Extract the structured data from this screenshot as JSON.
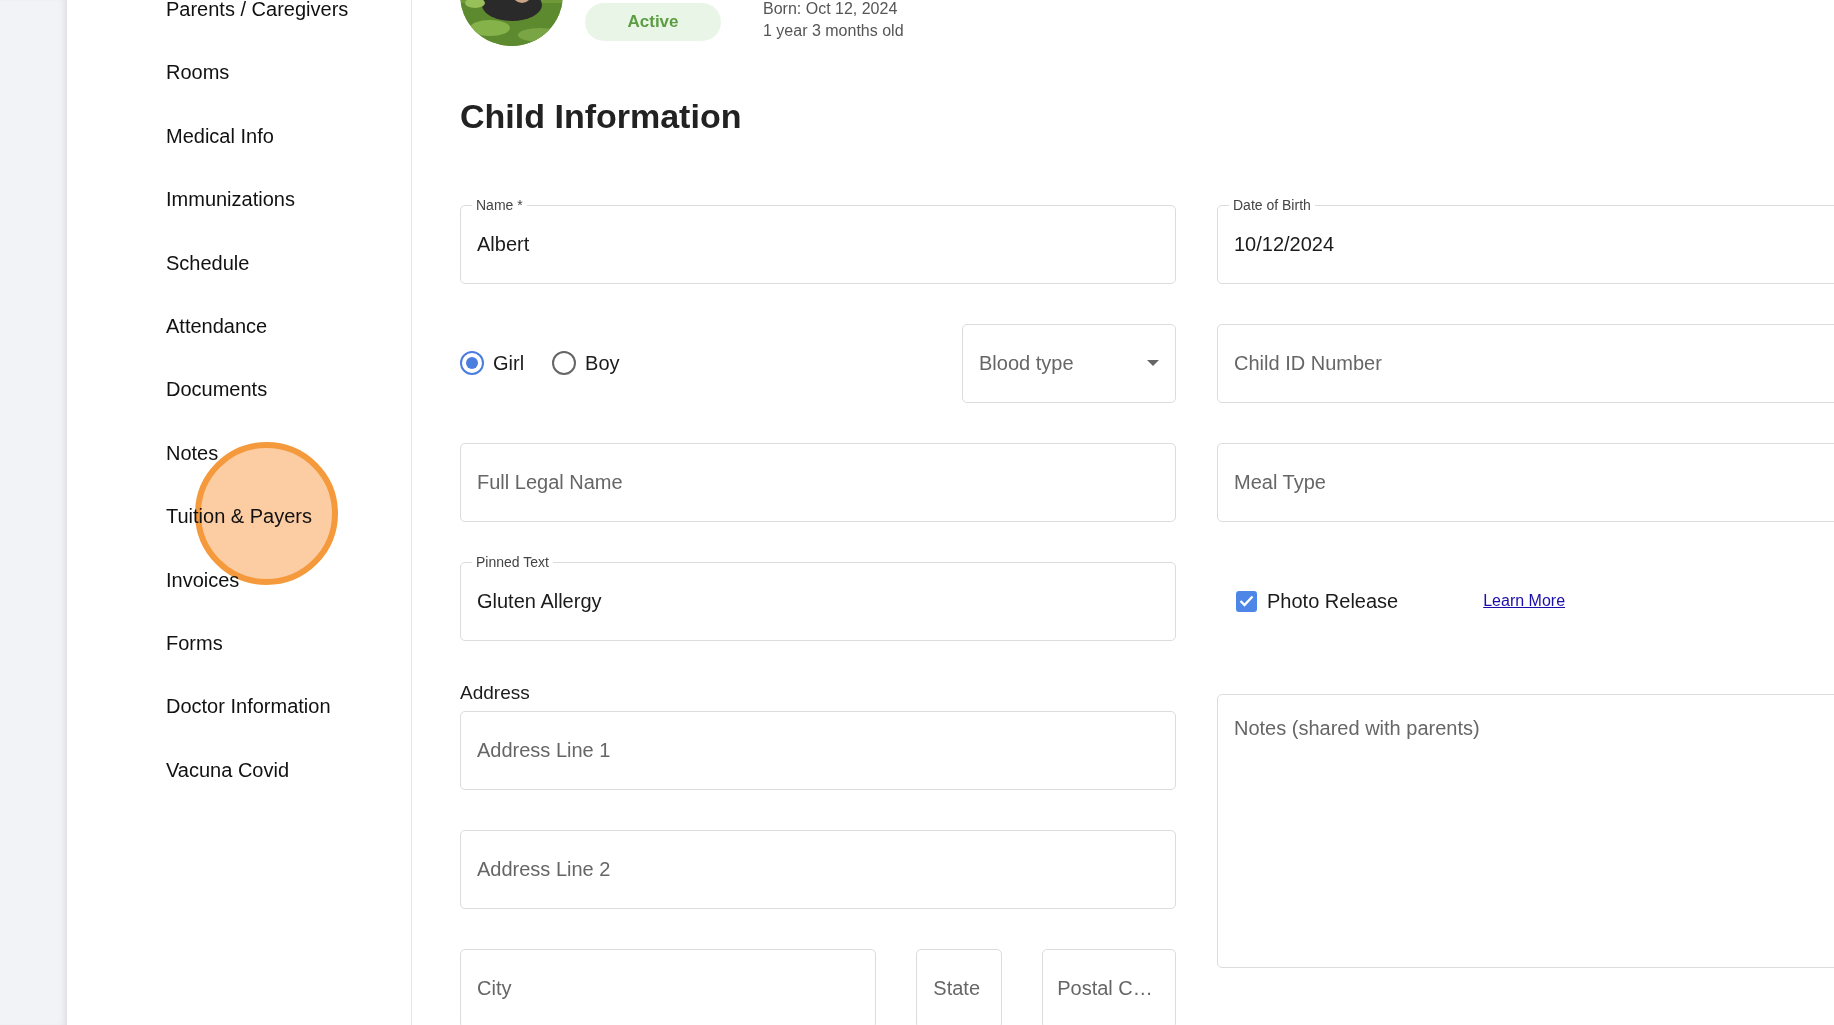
{
  "sidebar": {
    "items": [
      {
        "label": "Parents / Caregivers"
      },
      {
        "label": "Rooms"
      },
      {
        "label": "Medical Info"
      },
      {
        "label": "Immunizations"
      },
      {
        "label": "Schedule"
      },
      {
        "label": "Attendance"
      },
      {
        "label": "Documents"
      },
      {
        "label": "Notes"
      },
      {
        "label": "Tuition & Payers"
      },
      {
        "label": "Invoices"
      },
      {
        "label": "Forms"
      },
      {
        "label": "Doctor Information"
      },
      {
        "label": "Vacuna Covid"
      }
    ]
  },
  "child_header": {
    "status": "Active",
    "born": "Born: Oct 12, 2024",
    "age": "1 year 3 months old"
  },
  "title": "Child Information",
  "form": {
    "name": {
      "label": "Name *",
      "value": "Albert"
    },
    "date_of_birth": {
      "label": "Date of Birth",
      "value": "10/12/2024"
    },
    "gender": [
      {
        "label": "Girl",
        "selected": true
      },
      {
        "label": "Boy",
        "selected": false
      }
    ],
    "blood_type": {
      "placeholder": "Blood type"
    },
    "child_id": {
      "placeholder": "Child ID Number"
    },
    "full_legal_name": {
      "placeholder": "Full Legal Name"
    },
    "meal_type": {
      "placeholder": "Meal Type"
    },
    "pinned_text": {
      "label": "Pinned Text",
      "value": "Gluten Allergy"
    },
    "photo_release": {
      "label": "Photo Release",
      "checked": true,
      "link": "Learn More"
    },
    "address": {
      "label": "Address",
      "line1": {
        "placeholder": "Address Line 1"
      },
      "line2": {
        "placeholder": "Address Line 2"
      },
      "city": {
        "placeholder": "City"
      },
      "state": {
        "placeholder": "State"
      },
      "postal_code": {
        "placeholder": "Postal C…"
      }
    },
    "notes": {
      "placeholder": "Notes (shared with parents)"
    }
  }
}
